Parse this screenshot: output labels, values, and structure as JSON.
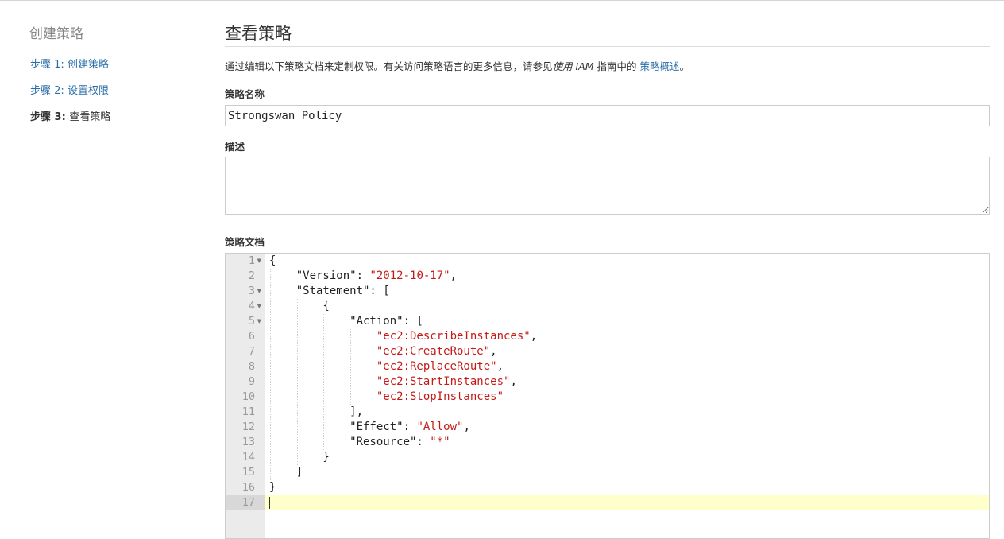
{
  "sidebar": {
    "title": "创建策略",
    "steps": [
      {
        "prefix": "步骤 1:",
        "name": "创建策略",
        "state": "link"
      },
      {
        "prefix": "步骤 2:",
        "name": "设置权限",
        "state": "link"
      },
      {
        "prefix": "步骤 3:",
        "name": "查看策略",
        "state": "current"
      }
    ]
  },
  "main": {
    "title": "查看策略",
    "intro": {
      "before": "通过编辑以下策略文档来定制权限。有关访问策略语言的更多信息，请参见",
      "guide_name": "使用 IAM",
      "middle": " 指南中的 ",
      "link": "策略概述",
      "after": "。"
    },
    "policy_name_label": "策略名称",
    "policy_name_value": "Strongswan_Policy",
    "description_label": "描述",
    "description_value": "",
    "document_label": "策略文档"
  },
  "editor": {
    "active_line": 17,
    "fold_lines": [
      1,
      3,
      4,
      5
    ],
    "lines": [
      [
        [
          "p",
          "{"
        ]
      ],
      [
        [
          "p",
          "    \"Version\": "
        ],
        [
          "s",
          "\"2012-10-17\""
        ],
        [
          "p",
          ","
        ]
      ],
      [
        [
          "p",
          "    \"Statement\": ["
        ]
      ],
      [
        [
          "p",
          "        {"
        ]
      ],
      [
        [
          "p",
          "            \"Action\": ["
        ]
      ],
      [
        [
          "p",
          "                "
        ],
        [
          "s",
          "\"ec2:DescribeInstances\""
        ],
        [
          "p",
          ","
        ]
      ],
      [
        [
          "p",
          "                "
        ],
        [
          "s",
          "\"ec2:CreateRoute\""
        ],
        [
          "p",
          ","
        ]
      ],
      [
        [
          "p",
          "                "
        ],
        [
          "s",
          "\"ec2:ReplaceRoute\""
        ],
        [
          "p",
          ","
        ]
      ],
      [
        [
          "p",
          "                "
        ],
        [
          "s",
          "\"ec2:StartInstances\""
        ],
        [
          "p",
          ","
        ]
      ],
      [
        [
          "p",
          "                "
        ],
        [
          "s",
          "\"ec2:StopInstances\""
        ]
      ],
      [
        [
          "p",
          "            ],"
        ]
      ],
      [
        [
          "p",
          "            \"Effect\": "
        ],
        [
          "s",
          "\"Allow\""
        ],
        [
          "p",
          ","
        ]
      ],
      [
        [
          "p",
          "            \"Resource\": "
        ],
        [
          "s",
          "\"*\""
        ]
      ],
      [
        [
          "p",
          "        }"
        ]
      ],
      [
        [
          "p",
          "    ]"
        ]
      ],
      [
        [
          "p",
          "}"
        ]
      ],
      []
    ]
  }
}
